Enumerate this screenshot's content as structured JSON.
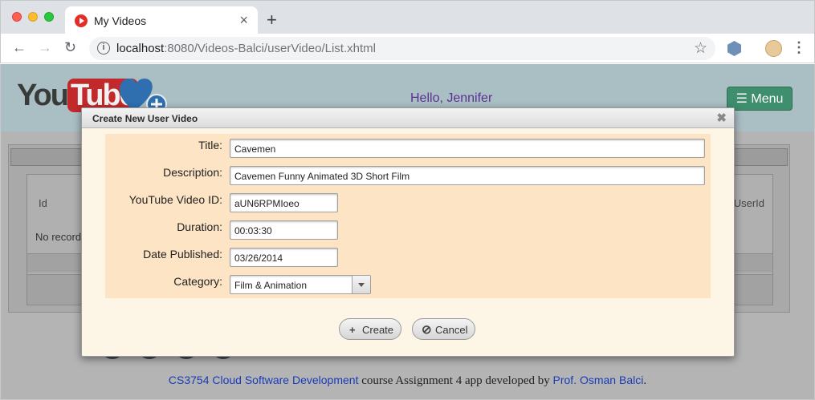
{
  "browser": {
    "tab_title": "My Videos",
    "tab_close": "×",
    "new_tab": "+",
    "url_host": "localhost",
    "url_rest": ":8080/Videos-Balci/userVideo/List.xhtml"
  },
  "header": {
    "logo_you": "You",
    "logo_tube": "Tube",
    "greeting": "Hello, Jennifer",
    "menu_label": "☰ Menu"
  },
  "background_table": {
    "col_id": "Id",
    "col_userid": "UserId",
    "empty_message": "No records found."
  },
  "dialog": {
    "title": "Create New User Video",
    "close": "✖",
    "fields": {
      "title_label": "Title:",
      "title_value": "Cavemen",
      "description_label": "Description:",
      "description_value": "Cavemen Funny Animated 3D Short Film",
      "video_id_label": "YouTube Video ID:",
      "video_id_value": "aUN6RPMIoeo",
      "duration_label": "Duration:",
      "duration_value": "00:03:30",
      "date_label": "Date Published:",
      "date_value": "03/26/2014",
      "category_label": "Category:",
      "category_value": "Film & Animation"
    },
    "create_icon": "+",
    "create_label": "Create",
    "cancel_icon": "⊘",
    "cancel_label": "Cancel"
  },
  "footer": {
    "course_link": "CS3754 Cloud Software Development",
    "text": " course Assignment 4 app developed by ",
    "author_link": "Prof. Osman Balci",
    "end": "."
  },
  "colors": {
    "header_bg": "#a9bfc4",
    "menu_button": "#3f8e6e",
    "greeting": "#5b2f93",
    "dialog_bg": "#fdf5e6",
    "form_panel": "#fde4c4",
    "link": "#1a3bb8"
  }
}
